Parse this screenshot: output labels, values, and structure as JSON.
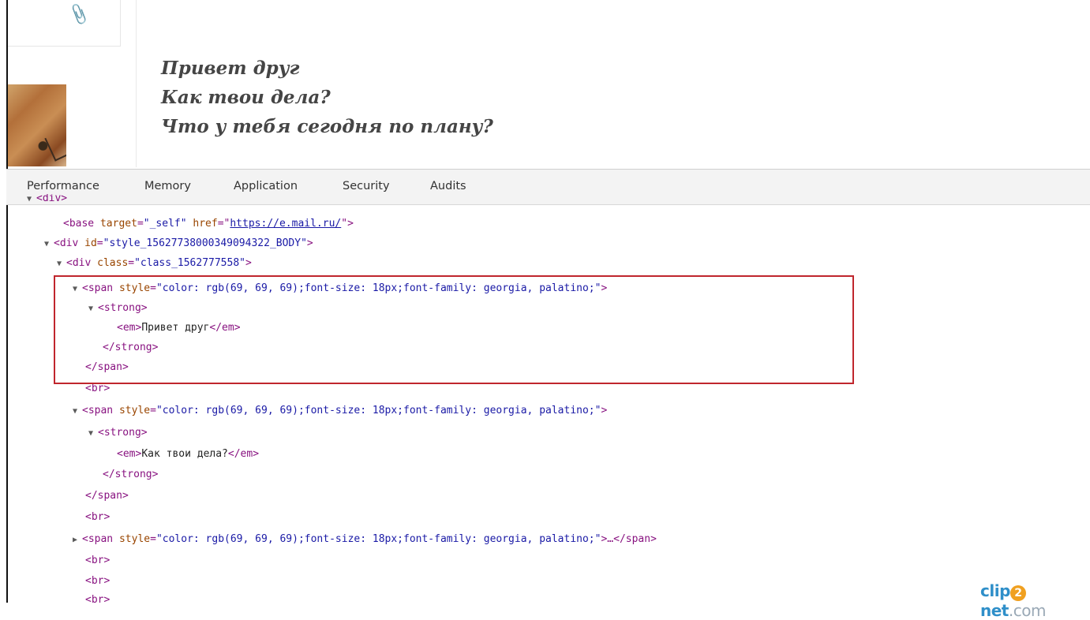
{
  "email": {
    "attachment_icon": "paperclip-icon",
    "lines": [
      "Привет друг",
      "Как твои дела?",
      "Что у тебя сегодня по плану?"
    ],
    "text_color": "#454545"
  },
  "devtools": {
    "tabs": [
      "Performance",
      "Memory",
      "Application",
      "Security",
      "Audits"
    ],
    "tree": {
      "line0": "<div>",
      "base": {
        "tag_open": "<base ",
        "a1": "target",
        "v1": "\"_self\"",
        "a2": " href",
        "eq": "=\"",
        "href": "https://e.mail.ru/",
        "close": "\">"
      },
      "body_div": {
        "tag_open": "<div ",
        "attr": "id",
        "val": "\"style_15627738000349094322_BODY\"",
        "close": ">"
      },
      "class_div": {
        "tag_open": "<div ",
        "attr": "class",
        "val": "\"class_1562777558\"",
        "close": ">"
      },
      "span_open": {
        "tag_open": "<span ",
        "attr": "style",
        "val": "\"color: rgb(69, 69, 69);font-size: 18px;font-family: georgia, palatino;\"",
        "close": ">"
      },
      "strong_open": "<strong>",
      "em_open": "<em>",
      "em_close": "</em>",
      "em1_text": "Привет друг",
      "em2_text": "Как твои дела?",
      "strong_close": "</strong>",
      "span_close": "</span>",
      "br": "<br>",
      "collapsed_span_close": ">…</span>"
    }
  },
  "highlight_color": "#c0262d",
  "watermark": {
    "a": "clip",
    "b": "2",
    "c": "net",
    "d": ".com"
  }
}
